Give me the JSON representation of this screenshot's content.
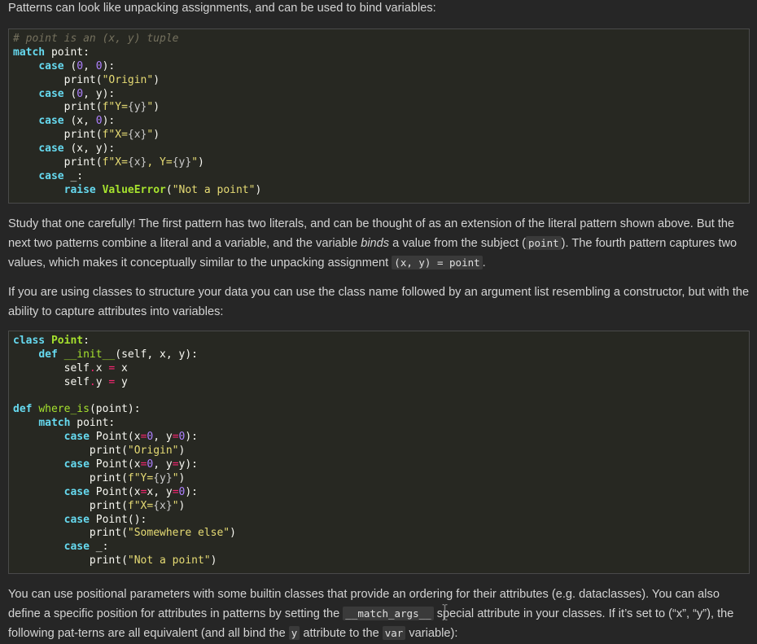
{
  "p1": "Patterns can look like unpacking assignments, and can be used to bind variables:",
  "code1": {
    "l1": "# point is an (x, y) tuple",
    "kw_match": "match",
    "point_colon": " point:",
    "kw_case": "case",
    "pr": "print",
    "s_origin": "\"Origin\"",
    "s_y": "f\"Y=",
    "s_x": "f\"X=",
    "s_xy": "f\"X=",
    "brace_y": "{y}",
    "brace_x": "{x}",
    "s_comma_y": ", Y=",
    "s_end": "\"",
    "under": "_",
    "kw_raise": "raise",
    "err": "ValueError",
    "s_notpoint": "\"Not a point\""
  },
  "p2": {
    "t1": "Study that one carefully! The first pattern has two literals, and can be thought of as an extension of the literal pattern shown above. But the next two patterns combine a literal and a variable, and the variable ",
    "em": "binds",
    "t2": " a value from the subject (",
    "code_point": "point",
    "t3": "). The fourth pattern captures two values, which makes it conceptually similar to the unpacking assignment ",
    "code_assign": "(x, y) = point",
    "t4": "."
  },
  "p3": "If you are using classes to structure your data you can use the class name followed by an argument list resembling a constructor, but with the ability to capture attributes into variables:",
  "code2": {
    "kw_class": "class",
    "cls_point": "Point",
    "kw_def": "def",
    "init": "__init__",
    "where_is": "where_is",
    "s_somewhere": "\"Somewhere else\""
  },
  "p4": {
    "t1": "You can use positional parameters with some builtin classes that provide an ordering for their attributes (e.g. dataclasses). You can also define a specific position for attributes in patterns by setting the ",
    "code_match_args": "__match_args__",
    "t2": " special attribute in your classes. If it’s set to (“x”, “y”), the following pat-terns are all equivalent (and all bind the ",
    "code_y": "y",
    "t3": " attribute to the ",
    "code_var": "var",
    "t4": " variable):"
  }
}
